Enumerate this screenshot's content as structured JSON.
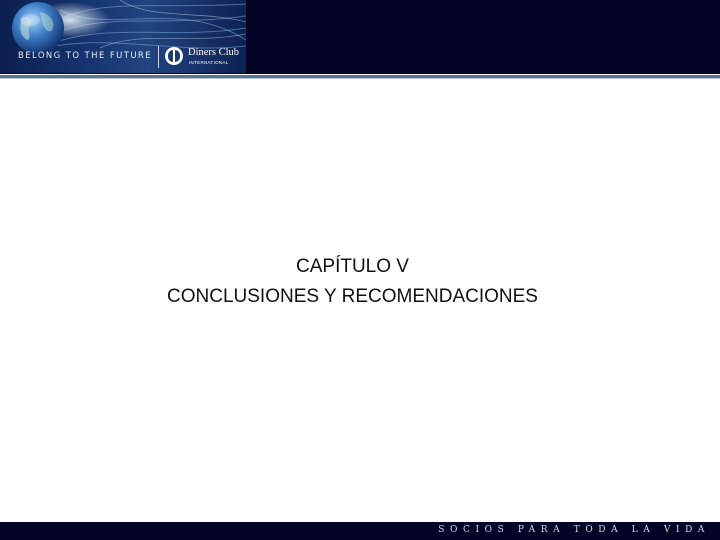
{
  "header": {
    "tagline": "BELONG TO THE FUTURE",
    "brand_name": "Diners Club",
    "brand_sub": "INTERNATIONAL",
    "band_color": "#020325",
    "rule_color": "#5a7394"
  },
  "main": {
    "title_line1": "CAPÍTULO V",
    "title_line2": "CONCLUSIONES Y RECOMENDACIONES"
  },
  "footer": {
    "motto": "SOCIOS PARA TODA LA VIDA",
    "band_color": "#020325"
  },
  "icons": {
    "globe": "globe-icon",
    "logo": "diners-club-logo-icon"
  }
}
